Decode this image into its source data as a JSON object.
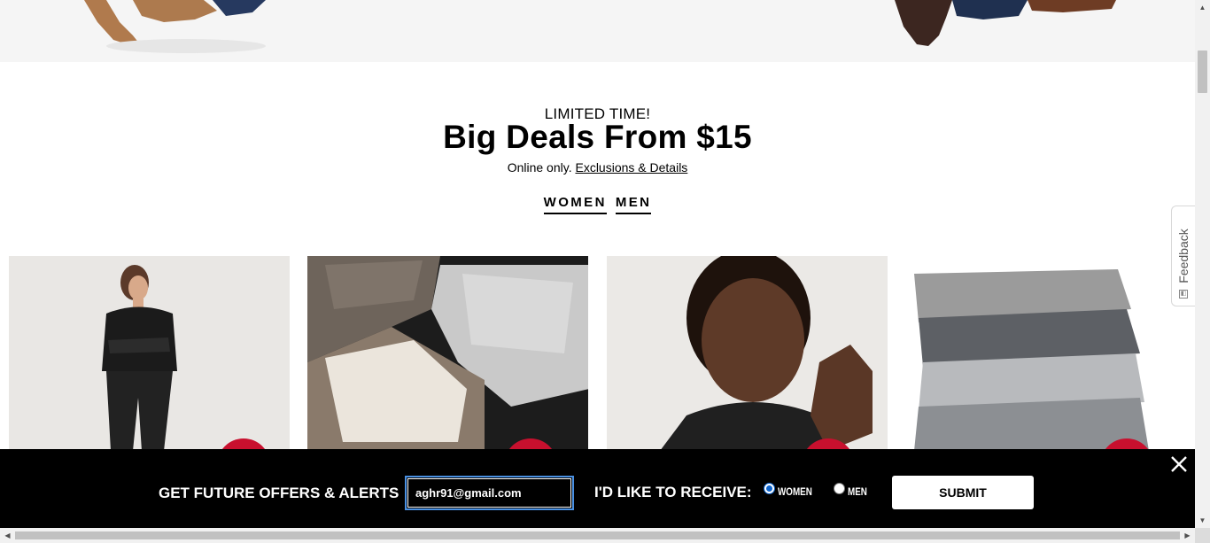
{
  "hero": {
    "left_image": "boots-and-jeans-photo",
    "right_image": "gloves-and-shoes-photo"
  },
  "promo": {
    "kicker": "LIMITED TIME!",
    "headline": "Big Deals From $15",
    "sub_text": "Online only.",
    "details_link": "Exclusions & Details",
    "tabs": [
      {
        "label": "WOMEN"
      },
      {
        "label": "MEN"
      }
    ]
  },
  "products": [
    {
      "image": "woman-in-black-lace-top-photo"
    },
    {
      "image": "folded-turtleneck-sweaters-photo"
    },
    {
      "image": "man-in-black-tee-photo"
    },
    {
      "image": "stacked-grey-jeans-photo"
    }
  ],
  "feedback": {
    "label": "Feedback"
  },
  "email_signup": {
    "heading": "GET FUTURE OFFERS & ALERTS",
    "email_value": "aghr91@gmail.com",
    "receive_label": "I'D LIKE TO RECEIVE:",
    "options": [
      {
        "label": "WOMEN",
        "selected": true
      },
      {
        "label": "MEN",
        "selected": false
      }
    ],
    "submit_label": "SUBMIT",
    "close_icon": "close-icon"
  },
  "colors": {
    "bar_background": "#000000",
    "focus_ring": "#4a90e2",
    "radio_selected": "#0b63ce"
  }
}
